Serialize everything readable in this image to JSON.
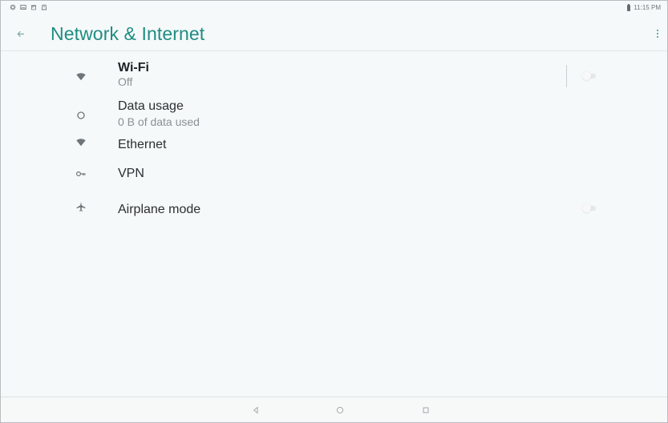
{
  "status_bar": {
    "time": "11:15 PM",
    "icons": [
      "settings-icon",
      "photo-icon",
      "calendar-icon",
      "storage-icon",
      "battery-icon"
    ]
  },
  "header": {
    "title": "Network & Internet",
    "back_icon": "arrow-left-icon",
    "menu_icon": "more-vertical-icon"
  },
  "settings": {
    "items": [
      {
        "title": "Wi-Fi",
        "summary": "Off",
        "icon": "wifi-icon",
        "has_toggle": true,
        "toggle_on": false
      },
      {
        "title": "Data usage",
        "summary": "0 B of data used",
        "icon": "data-usage-icon",
        "has_toggle": false
      },
      {
        "title": "Ethernet",
        "summary": "",
        "icon": "ethernet-icon",
        "has_toggle": false
      },
      {
        "title": "VPN",
        "summary": "",
        "icon": "vpn-key-icon",
        "has_toggle": false
      },
      {
        "title": "Airplane mode",
        "summary": "",
        "icon": "airplane-icon",
        "has_toggle": true,
        "toggle_on": false
      }
    ]
  },
  "navigation": {
    "buttons": [
      "back-nav-icon",
      "home-nav-icon",
      "recent-apps-icon"
    ]
  },
  "colors": {
    "accent": "#1f8c82",
    "background": "#f5f9f9",
    "text_primary": "#2b2f31",
    "text_secondary": "#8a9094",
    "icon": "#6f7679"
  }
}
